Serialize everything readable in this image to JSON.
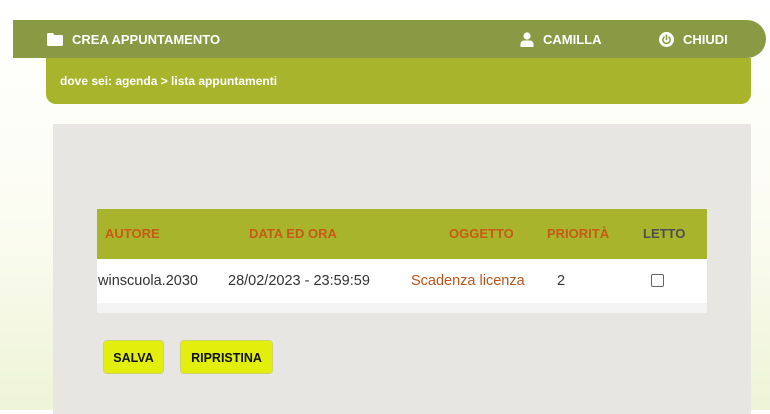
{
  "topbar": {
    "create_label": "CREA APPUNTAMENTO",
    "user_label": "CAMILLA",
    "close_label": "CHIUDI"
  },
  "breadcrumb": {
    "text": "dove sei: agenda > lista appuntamenti"
  },
  "table": {
    "headers": {
      "autore": "AUTORE",
      "data": "DATA ED ORA",
      "oggetto": "OGGETTO",
      "priorita": "PRIORITÀ",
      "letto": "LETTO"
    },
    "rows": [
      {
        "autore": "winscuola.2030",
        "data": "28/02/2023 - 23:59:59",
        "oggetto": "Scadenza licenza",
        "priorita": "2",
        "letto": false
      }
    ]
  },
  "buttons": {
    "save_label": "SALVA",
    "reset_label": "RIPRISTINA"
  },
  "colors": {
    "topbar": "#8a9a44",
    "accent": "#a8b52c",
    "header_text": "#c75a16",
    "button": "#e2ee0c",
    "panel": "#e7e6e3"
  },
  "icons": {
    "create": "folder-icon",
    "user": "user-icon",
    "close": "power-icon"
  }
}
